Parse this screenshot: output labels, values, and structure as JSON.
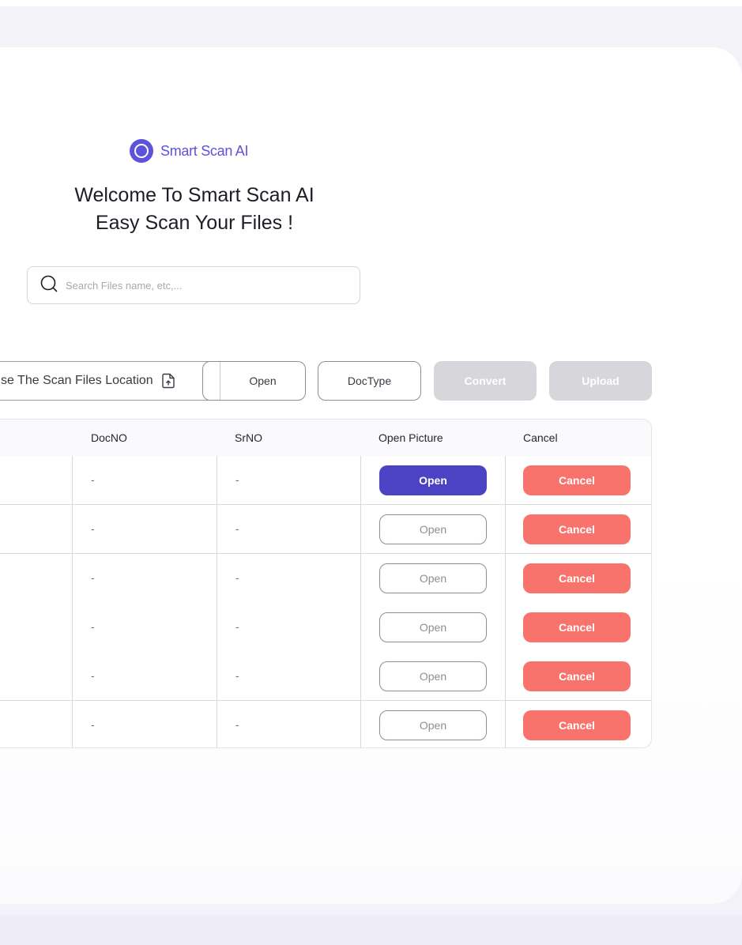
{
  "brand": {
    "name": "Smart Scan AI",
    "accent": "#5d52dc"
  },
  "welcome": {
    "line1": "Welcome To Smart Scan AI",
    "line2": "Easy Scan Your Files !"
  },
  "search": {
    "placeholder": "Search Files name, etc,...",
    "value": ""
  },
  "toolbar": {
    "location_label": "se The Scan Files Location",
    "open_label": "Open",
    "doctype_label": "DocType",
    "convert_label": "Convert",
    "upload_label": "Upload"
  },
  "table": {
    "headers": [
      "DocNO",
      "SrNO",
      "Open Picture",
      "Cancel"
    ],
    "rows": [
      {
        "docno": "-",
        "srno": "-",
        "open": "Open",
        "cancel": "Cancel"
      },
      {
        "docno": "-",
        "srno": "-",
        "open": "Open",
        "cancel": "Cancel"
      },
      {
        "docno": "-",
        "srno": "-",
        "open": "Open",
        "cancel": "Cancel"
      },
      {
        "docno": "-",
        "srno": "-",
        "open": "Open",
        "cancel": "Cancel"
      },
      {
        "docno": "-",
        "srno": "-",
        "open": "Open",
        "cancel": "Cancel"
      },
      {
        "docno": "-",
        "srno": "-",
        "open": "Open",
        "cancel": "Cancel"
      }
    ]
  },
  "colors": {
    "primary_button": "#4b43c3",
    "cancel_button": "#f8736b",
    "disabled_button": "#d7d7db"
  }
}
